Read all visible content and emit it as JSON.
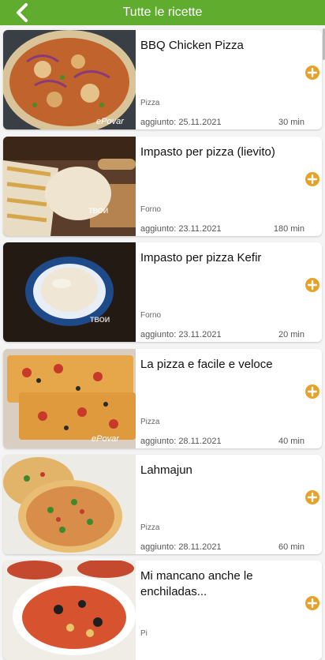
{
  "header": {
    "title": "Tutte le ricette"
  },
  "recipes": [
    {
      "title": "BBQ Chicken Pizza",
      "category": "Pizza",
      "date": "aggiunto: 25.11.2021",
      "time": "30 min",
      "watermark": "ePovar"
    },
    {
      "title": "Impasto per pizza (lievito)",
      "category": "Forno",
      "date": "aggiunto: 23.11.2021",
      "time": "180 min",
      "watermark": "твои рецепты"
    },
    {
      "title": "Impasto per pizza Kefir",
      "category": "Forno",
      "date": "aggiunto: 23.11.2021",
      "time": "20 min",
      "watermark": "твои рецепты"
    },
    {
      "title": "La pizza e facile e veloce",
      "category": "Pizza",
      "date": "aggiunto: 28.11.2021",
      "time": "40 min",
      "watermark": "ePovar"
    },
    {
      "title": "Lahmajun",
      "category": "Pizza",
      "date": "aggiunto: 28.11.2021",
      "time": "60 min",
      "watermark": ""
    },
    {
      "title": "Mi mancano anche le enchiladas...",
      "category": "Pi",
      "date": "",
      "time": "",
      "watermark": ""
    }
  ],
  "colors": {
    "appbar": "#5fac2f",
    "add_button": "#e8a128"
  },
  "icons": {
    "back": "chevron-left-icon",
    "add": "plus-circle-icon"
  }
}
